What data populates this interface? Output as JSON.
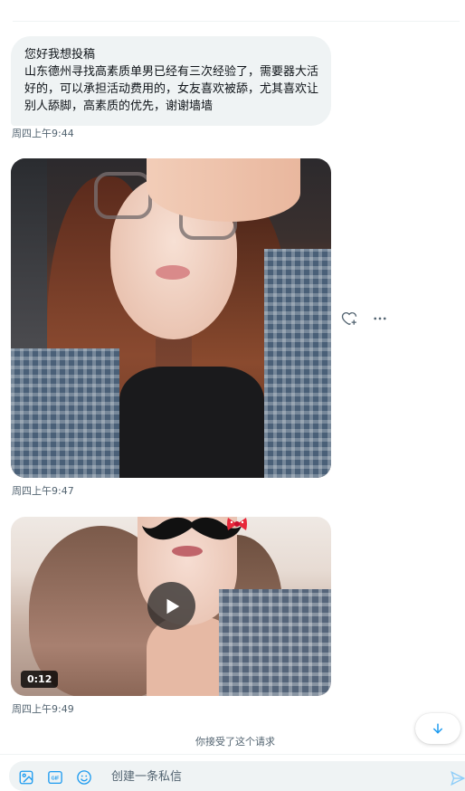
{
  "messages": [
    {
      "type": "text",
      "lines": [
        "您好我想投稿",
        "山东德州寻找高素质单男已经有三次经验了，需要器大活好的，可以承担活动费用的，女友喜欢被舔，尤其喜欢让别人舔脚，高素质的优先，谢谢墙墙"
      ],
      "timestamp": "周四上午9:44"
    },
    {
      "type": "photo",
      "timestamp": "周四上午9:47"
    },
    {
      "type": "video",
      "duration": "0:12",
      "timestamp": "周四上午9:49"
    }
  ],
  "system_message": "你接受了这个请求",
  "composer": {
    "placeholder": "创建一条私信"
  },
  "colors": {
    "accent": "#1d9bf0",
    "bubble_bg": "#eff3f4",
    "muted_text": "#536471"
  },
  "icons": {
    "photo_actions": [
      "heart-plus-icon",
      "more-icon"
    ],
    "composer_tools": [
      "image-icon",
      "gif-icon",
      "emoji-icon"
    ],
    "send": "send-icon",
    "scroll": "arrow-down-icon",
    "video": "play-icon"
  }
}
